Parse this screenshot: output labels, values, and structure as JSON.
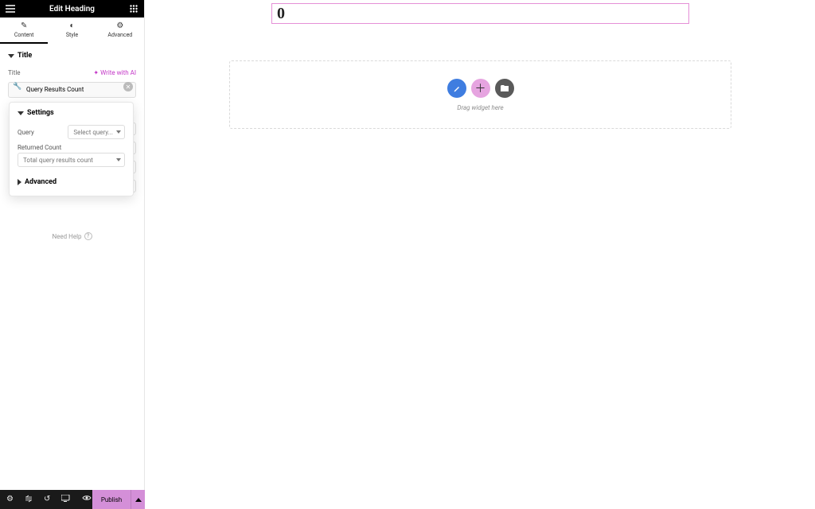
{
  "header": {
    "title": "Edit Heading"
  },
  "tabs": {
    "content": "Content",
    "style": "Style",
    "advanced": "Advanced"
  },
  "title_section": {
    "label": "Title",
    "field_label": "Title",
    "ai_link": "Write with AI",
    "value": "Query Results Count"
  },
  "popover": {
    "settings_label": "Settings",
    "query_label": "Query",
    "query_placeholder": "Select query...",
    "returned_label": "Returned Count",
    "returned_value": "Total query results count",
    "advanced_label": "Advanced"
  },
  "help": {
    "label": "Need Help"
  },
  "footer": {
    "publish": "Publish"
  },
  "canvas": {
    "heading_value": "0",
    "drop_hint": "Drag widget here"
  }
}
